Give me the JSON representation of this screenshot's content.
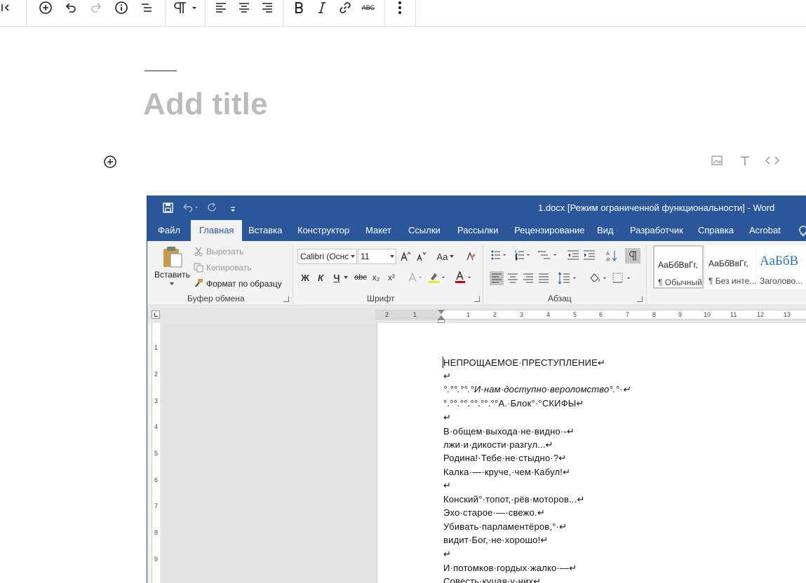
{
  "toolbar": {
    "buttons": [
      "collapse-sidebar",
      "add-block",
      "undo",
      "redo",
      "details",
      "outline",
      "paragraph",
      "align-left",
      "align-center",
      "align-right",
      "bold",
      "italic",
      "link",
      "strikethrough",
      "more-options"
    ],
    "strike_label": "ABC"
  },
  "editor": {
    "title_placeholder": "Add title"
  },
  "word": {
    "window_title": "1.docx [Режим ограниченной функциональности]  -  Word",
    "tabs": [
      "Файл",
      "Главная",
      "Вставка",
      "Конструктор",
      "Макет",
      "Ссылки",
      "Рассылки",
      "Рецензирование",
      "Вид",
      "Разработчик",
      "Справка",
      "Acrobat"
    ],
    "active_tab": "Главная",
    "clipboard": {
      "paste_label": "Вставить",
      "cut_label": "Вырезать",
      "copy_label": "Копировать",
      "format_painter_label": "Формат по образцу",
      "group_label": "Буфер обмена"
    },
    "font": {
      "font_name": "Calibri (Оснс",
      "font_size": "11",
      "change_case_label": "Aa",
      "bold_label": "Ж",
      "italic_label": "К",
      "underline_label": "Ч",
      "strike_label": "abc",
      "subscript_label": "x₂",
      "superscript_label": "x²",
      "group_label": "Шрифт"
    },
    "paragraph": {
      "group_label": "Абзац"
    },
    "styles": [
      {
        "sample": "АаБбВвГг,",
        "name": "¶ Обычный"
      },
      {
        "sample": "АаБбВвГг,",
        "name": "¶ Без инте..."
      },
      {
        "sample": "АаБбВ",
        "name": "Заголово..."
      }
    ],
    "ruler": {
      "h_numbers": [
        "2",
        "1",
        "1",
        "2",
        "3",
        "4",
        "5",
        "6",
        "7",
        "8",
        "9",
        "10",
        "11",
        "12",
        "13"
      ],
      "v_numbers": [
        "1",
        "2",
        "3",
        "4",
        "5",
        "6",
        "7",
        "8",
        "9"
      ]
    },
    "document_lines": [
      "НЕПРОЩАЕМОЕ·ПРЕСТУПЛЕНИЕ↵",
      "↵",
      "°.°°.°°.°И·нам·доступно·вероломство°.°·↵",
      "°.°°.°°.°°.°°.°°А.·Блок°·°СКИФЫ↵",
      "↵",
      "В·общем·выхода·не·видно·-↵",
      "лжи·и·дикости·разгул...↵",
      "Родина!·Тебе·не·стыдно·?↵",
      "Калка·—·круче,·чем·Кабул!↵",
      "↵",
      "Конский°·топот,·рёв·моторов...↵",
      "Эхо·старое·—·свежо.↵",
      "Убивать·парламентёров,°·↵",
      "видит·Бог,·не·хорошо!↵",
      "↵",
      "И·потомков·гордых·жалко·—↵",
      "Совесть·куцая·у·них↵"
    ]
  }
}
